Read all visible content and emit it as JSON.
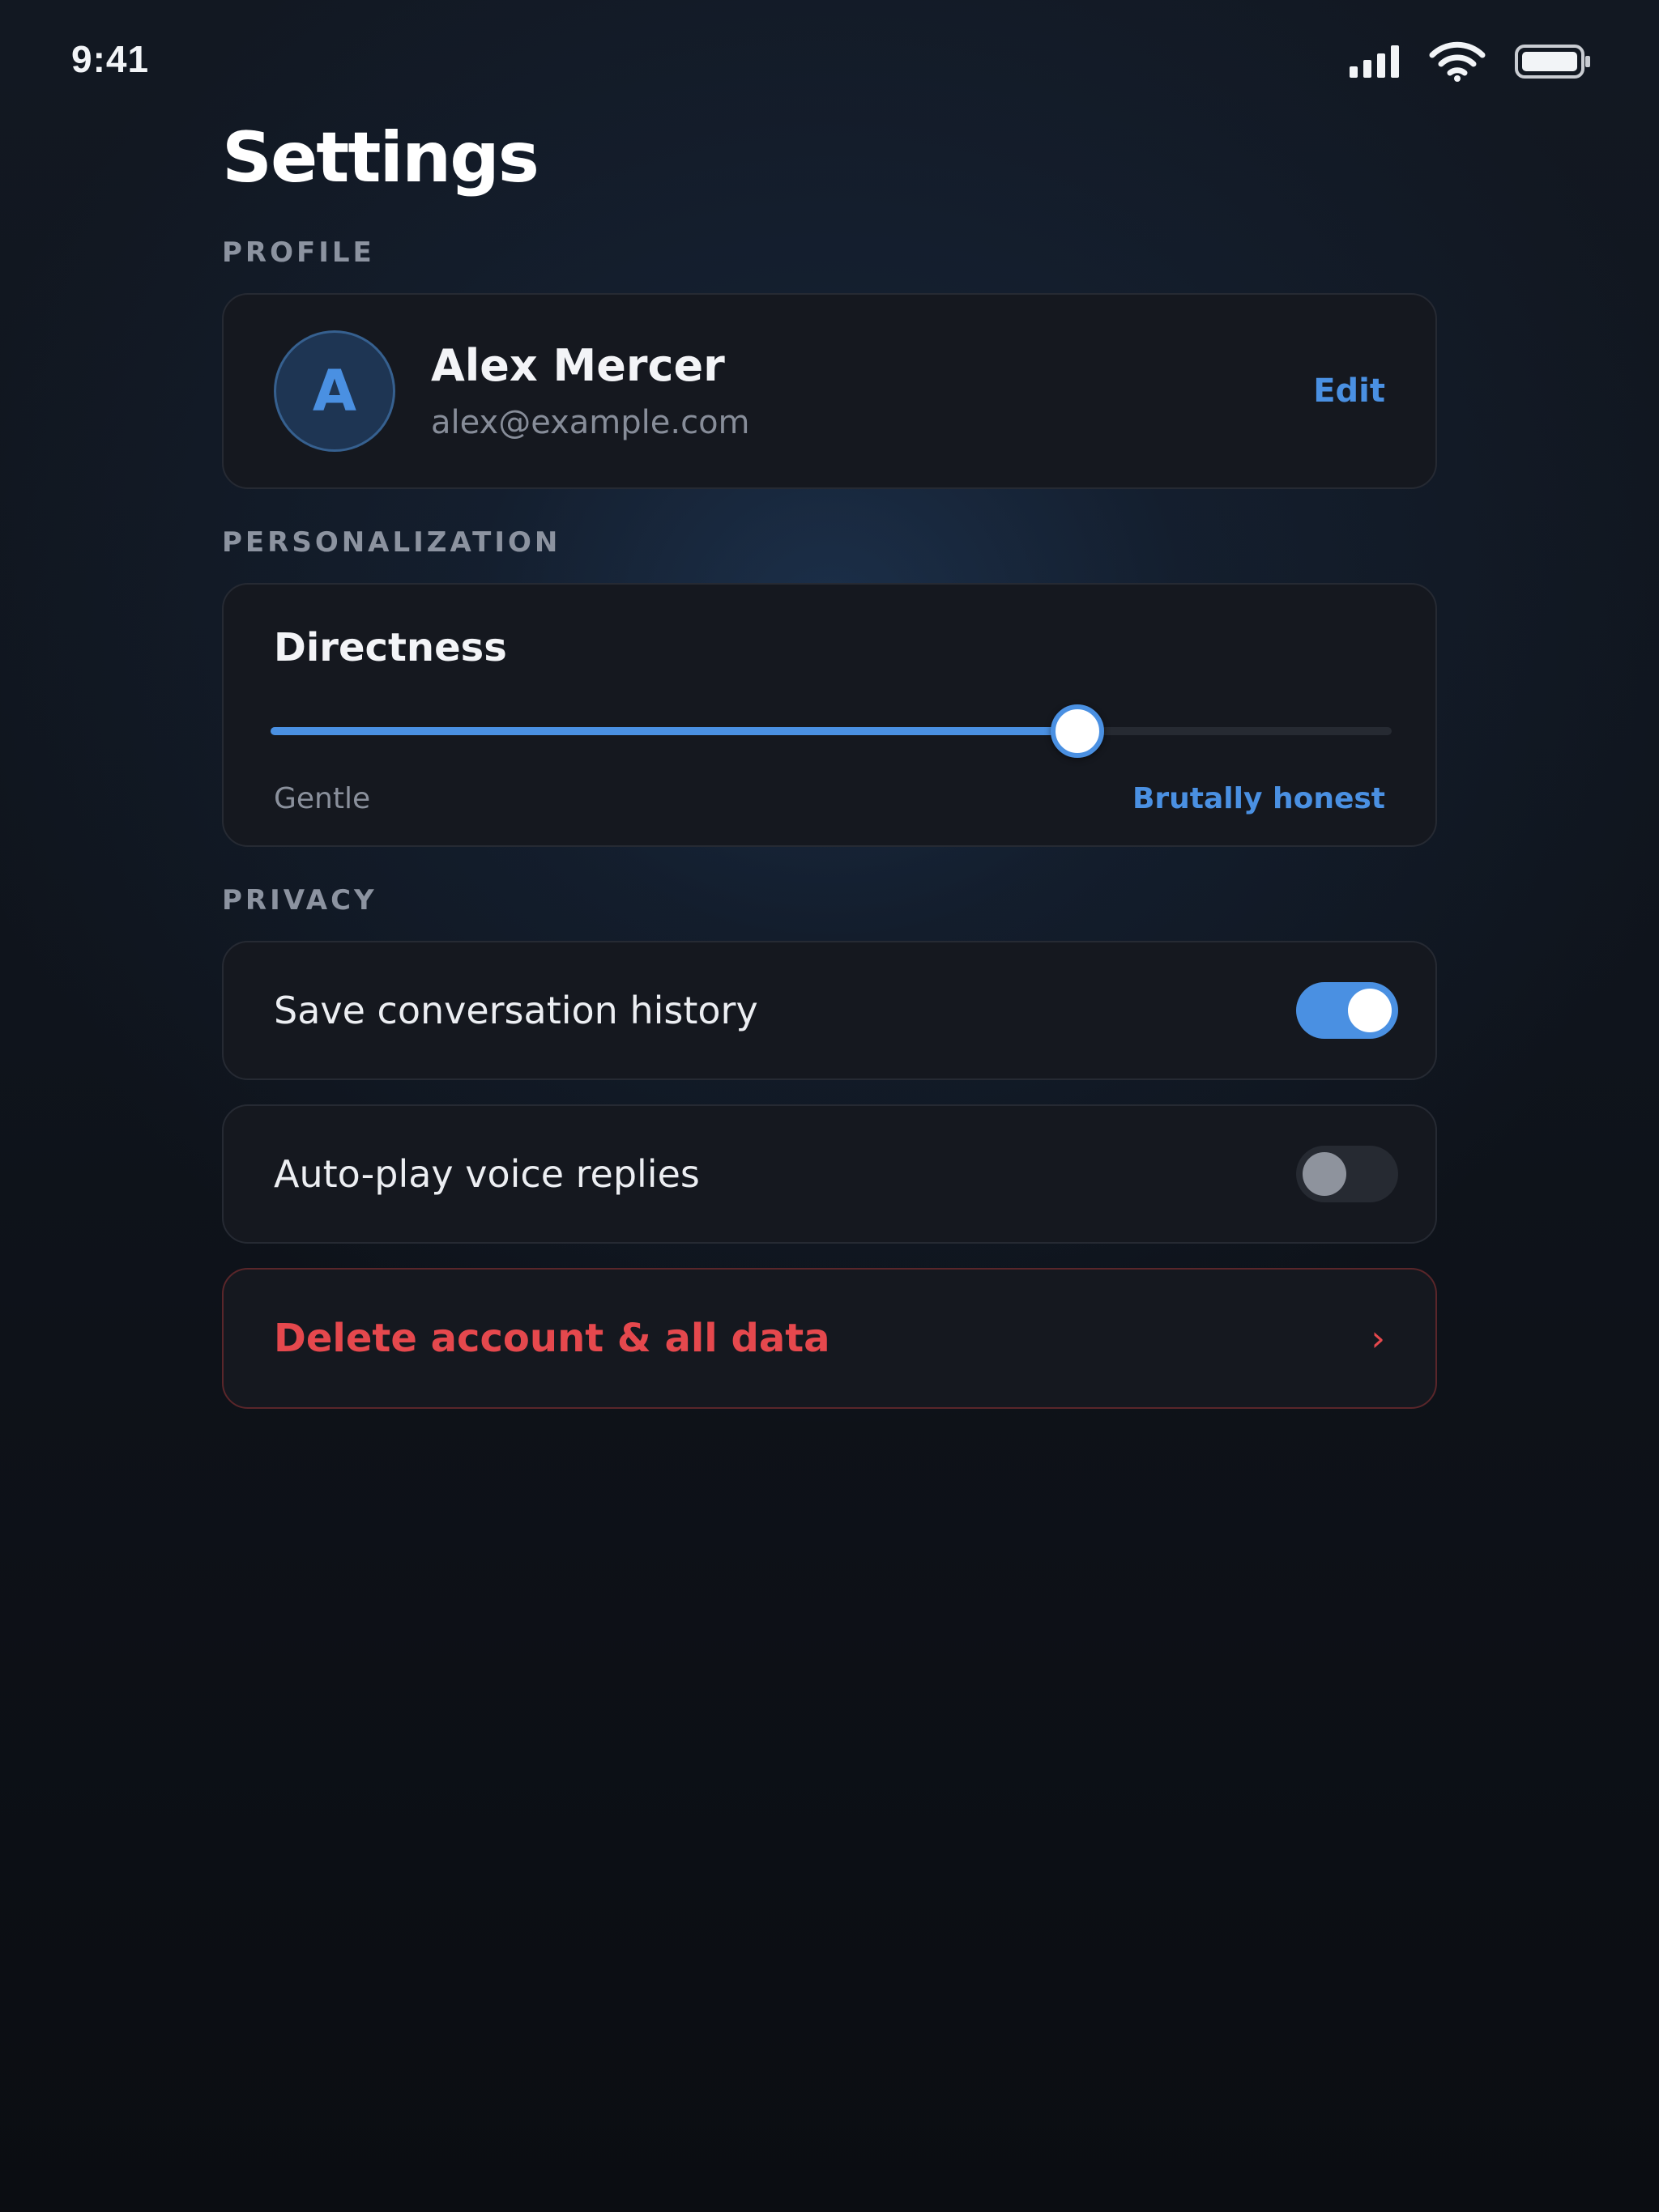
{
  "status_bar": {
    "time": "9:41",
    "icons": [
      "cellular-signal-icon",
      "wifi-icon",
      "battery-icon"
    ]
  },
  "page": {
    "title": "Settings"
  },
  "profile": {
    "section_label": "PROFILE",
    "avatar_initial": "A",
    "name": "Alex Mercer",
    "email": "alex@example.com",
    "edit_label": "Edit"
  },
  "personalization": {
    "section_label": "PERSONALIZATION",
    "slider": {
      "title": "Directness",
      "min_label": "Gentle",
      "max_label": "Brutally honest",
      "value": 0.72
    }
  },
  "privacy": {
    "section_label": "PRIVACY",
    "toggles": [
      {
        "label": "Save conversation history",
        "on": true
      },
      {
        "label": "Auto-play voice replies",
        "on": false
      }
    ]
  },
  "danger": {
    "delete_label": "Delete account & all data",
    "chevron": "›"
  },
  "colors": {
    "accent": "#4a90e2",
    "danger": "#e5484d",
    "card_bg": "#15181f",
    "background": "#0f141c"
  }
}
